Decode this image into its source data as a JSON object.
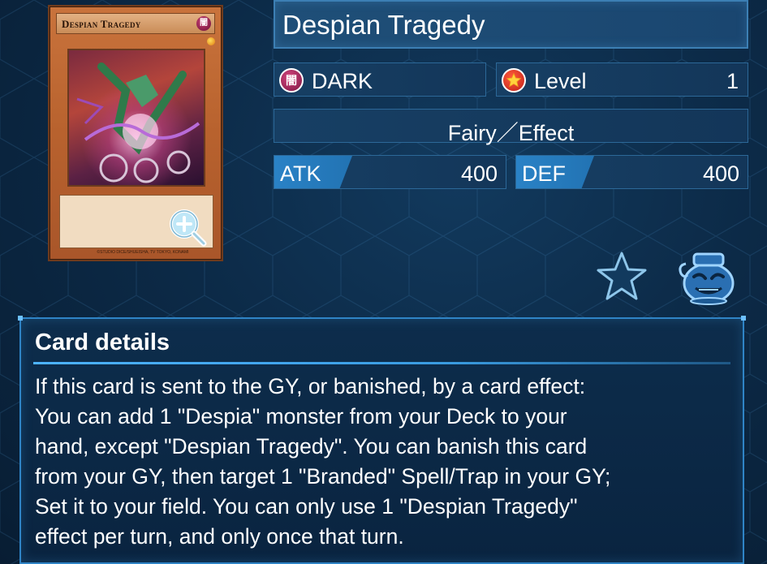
{
  "card": {
    "name": "Despian Tragedy",
    "thumbnail_name": "Despian Tragedy",
    "attribute_kanji": "闇",
    "copyright": "©STUDIO DICE/SHUEISHA, TV TOKYO, KONAMI"
  },
  "stats": {
    "attribute": "DARK",
    "level_label": "Level",
    "level_value": "1",
    "type": "Fairy／Effect",
    "atk_label": "ATK",
    "atk_value": "400",
    "def_label": "DEF",
    "def_value": "400"
  },
  "details": {
    "title": "Card details",
    "text": "If this card is sent to the GY, or banished, by a card effect:\nYou can add 1 \"Despia\" monster from your Deck to your\nhand, except \"Despian Tragedy\". You can banish this card\nfrom your GY, then target 1 \"Branded\" Spell/Trap in your GY;\nSet it to your field. You can only use 1 \"Despian Tragedy\"\neffect per turn, and only once that turn."
  },
  "icons": {
    "zoom": "zoom-in-icon",
    "favorite": "star-outline-icon",
    "pot": "pot-of-greed-icon",
    "attribute": "dark-attribute-icon",
    "level": "level-star-icon"
  },
  "colors": {
    "background": "#0c2a47",
    "panel_border": "#2f84c6",
    "tag_blue": "#2273b3",
    "card_frame": "#b8622e"
  }
}
